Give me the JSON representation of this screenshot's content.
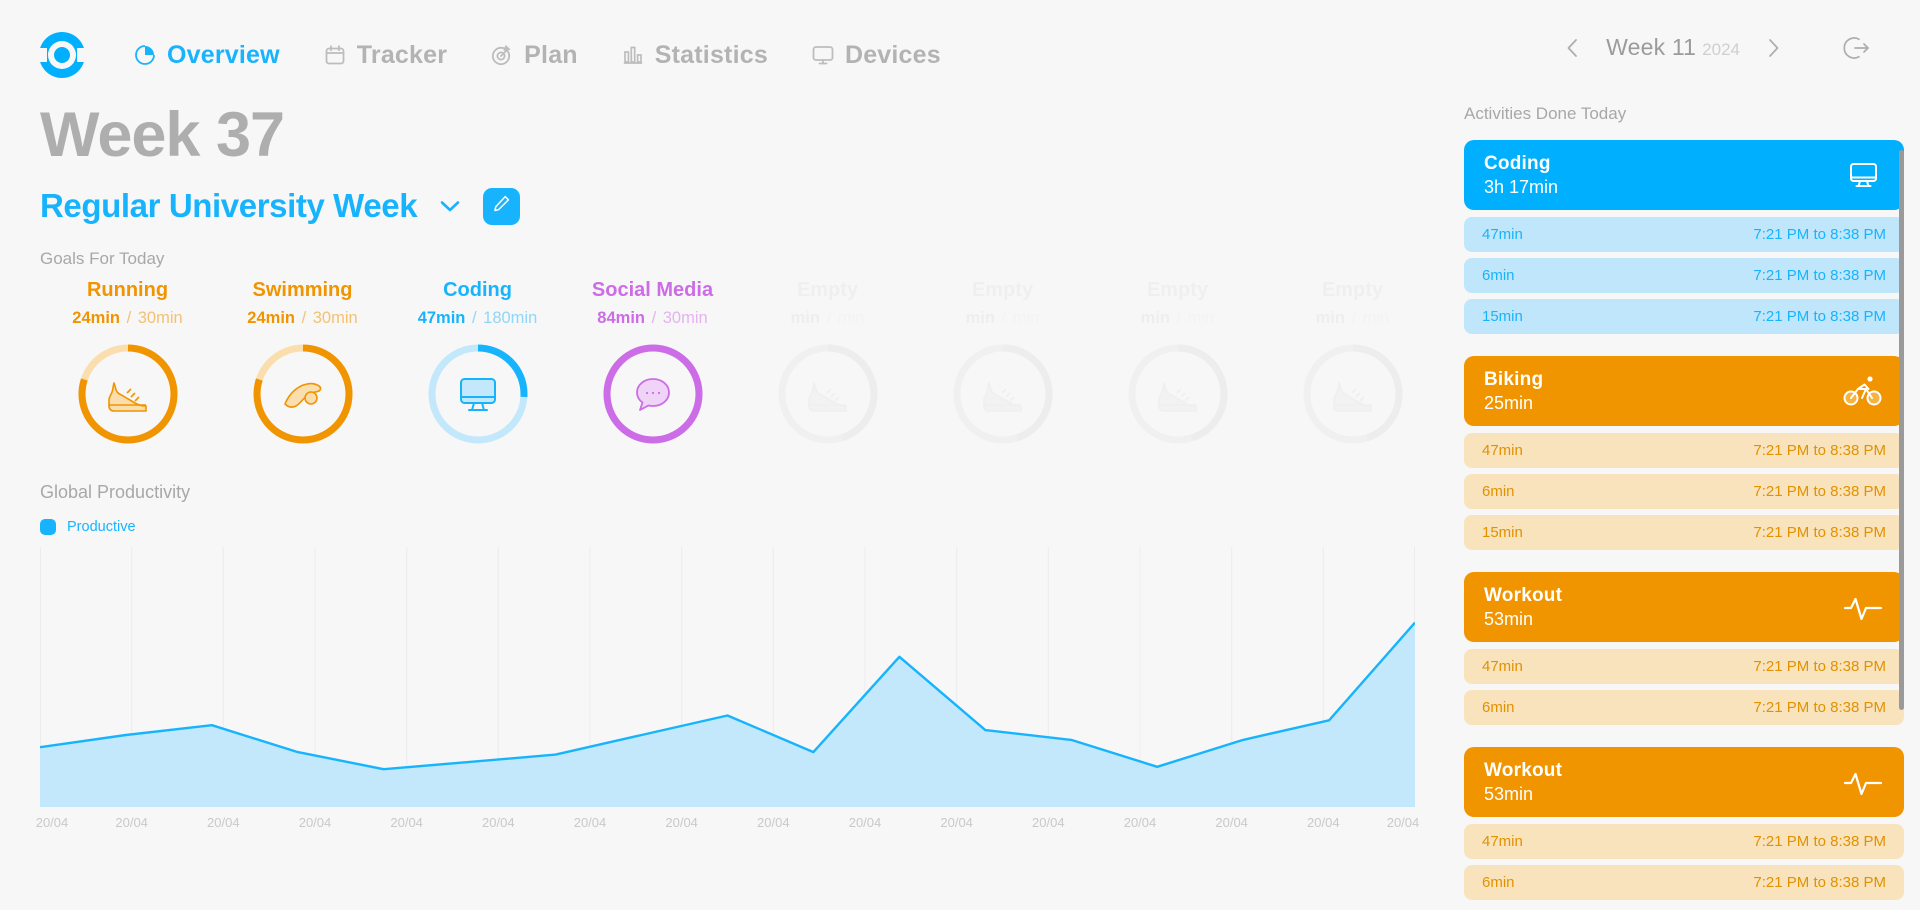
{
  "brand": {
    "logo_icon": "target-ring-logo",
    "accent_blue": "#17b4fd",
    "accent_orange": "#f09400",
    "accent_purple": "#cc6ce7",
    "empty_grey": "#ededed"
  },
  "header": {
    "nav": [
      {
        "label": "Overview",
        "icon": "pie-chart-icon",
        "active": true
      },
      {
        "label": "Tracker",
        "icon": "calendar-icon",
        "active": false
      },
      {
        "label": "Plan",
        "icon": "target-icon",
        "active": false
      },
      {
        "label": "Statistics",
        "icon": "bar-chart-icon",
        "active": false
      },
      {
        "label": "Devices",
        "icon": "monitor-icon",
        "active": false
      }
    ],
    "week_nav": {
      "prev_icon": "chevron-left-icon",
      "next_icon": "chevron-right-icon",
      "week_label": "Week 11",
      "year_label": "2024",
      "logout_icon": "logout-icon"
    }
  },
  "main": {
    "title": "Week 37",
    "subtitle": "Regular University Week",
    "dropdown_icon": "chevron-down-icon",
    "edit_icon": "pencil-icon",
    "goals_label": "Goals For Today"
  },
  "goals": [
    {
      "name": "Running",
      "current": "24min",
      "target": "30min",
      "separator": "/",
      "color": "#f09400",
      "icon": "running-shoe-icon",
      "percent": 80,
      "empty": false
    },
    {
      "name": "Swimming",
      "current": "24min",
      "target": "30min",
      "separator": "/",
      "color": "#f09400",
      "icon": "swimmer-icon",
      "percent": 80,
      "empty": false
    },
    {
      "name": "Coding",
      "current": "47min",
      "target": "180min",
      "separator": "/",
      "color": "#17b4fd",
      "icon": "monitor-icon",
      "percent": 26,
      "empty": false
    },
    {
      "name": "Social Media",
      "current": "84min",
      "target": "30min",
      "separator": "/",
      "color": "#cc6ce7",
      "icon": "chat-bubble-icon",
      "percent": 100,
      "empty": false
    },
    {
      "name": "Empty",
      "current": "min",
      "target": "min",
      "separator": "/",
      "color": "#ededed",
      "icon": "running-shoe-icon",
      "percent": 45,
      "empty": true
    },
    {
      "name": "Empty",
      "current": "min",
      "target": "min",
      "separator": "/",
      "color": "#ededed",
      "icon": "running-shoe-icon",
      "percent": 45,
      "empty": true
    },
    {
      "name": "Empty",
      "current": "min",
      "target": "min",
      "separator": "/",
      "color": "#ededed",
      "icon": "running-shoe-icon",
      "percent": 45,
      "empty": true
    },
    {
      "name": "Empty",
      "current": "min",
      "target": "min",
      "separator": "/",
      "color": "#ededed",
      "icon": "running-shoe-icon",
      "percent": 45,
      "empty": true
    }
  ],
  "chart_panel": {
    "title": "Global Productivity",
    "legend": [
      {
        "label": "Productive",
        "color": "#17b4fd"
      }
    ]
  },
  "chart_data": {
    "type": "area",
    "title": "Global Productivity",
    "xlabel": "",
    "ylabel": "",
    "grid": true,
    "legend": [
      "Productive"
    ],
    "legend_position": "top-left",
    "categories": [
      "20/04",
      "20/04",
      "20/04",
      "20/04",
      "20/04",
      "20/04",
      "20/04",
      "20/04",
      "20/04",
      "20/04",
      "20/04",
      "20/04",
      "20/04",
      "20/04",
      "20/04",
      "20/04"
    ],
    "x_tick_labels": [
      "20/04",
      "20/04",
      "20/04",
      "20/04",
      "20/04",
      "20/04",
      "20/04",
      "20/04",
      "20/04",
      "20/04",
      "20/04",
      "20/04",
      "20/04",
      "20/04",
      "20/04",
      "20/04"
    ],
    "ylim": [
      0,
      100
    ],
    "series": [
      {
        "name": "Productive",
        "color": "#17b4fd",
        "fill": "#c3e8fb",
        "values": [
          22,
          27,
          31,
          20,
          13,
          16,
          19,
          27,
          35,
          20,
          59,
          29,
          25,
          14,
          25,
          33,
          73
        ]
      }
    ]
  },
  "right_panel": {
    "title": "Activities Done Today",
    "groups": [
      {
        "name": "Coding",
        "total": "3h 17min",
        "icon": "monitor-icon",
        "theme": "blue",
        "head_bg": "#00b0ff",
        "row_bg": "#bfe6fb",
        "row_fg": "#17b4fd",
        "rows": [
          {
            "duration": "47min",
            "range": "7:21 PM to 8:38 PM"
          },
          {
            "duration": "6min",
            "range": "7:21 PM to 8:38 PM"
          },
          {
            "duration": "15min",
            "range": "7:21 PM to 8:38 PM"
          }
        ]
      },
      {
        "name": "Biking",
        "total": "25min",
        "icon": "bicycle-icon",
        "theme": "orange",
        "head_bg": "#f09400",
        "row_bg": "#f8e3bc",
        "row_fg": "#e29100",
        "rows": [
          {
            "duration": "47min",
            "range": "7:21 PM to 8:38 PM"
          },
          {
            "duration": "6min",
            "range": "7:21 PM to 8:38 PM"
          },
          {
            "duration": "15min",
            "range": "7:21 PM to 8:38 PM"
          }
        ]
      },
      {
        "name": "Workout",
        "total": "53min",
        "icon": "heartbeat-icon",
        "theme": "orange",
        "head_bg": "#f09400",
        "row_bg": "#f8e3bc",
        "row_fg": "#e29100",
        "rows": [
          {
            "duration": "47min",
            "range": "7:21 PM to 8:38 PM"
          },
          {
            "duration": "6min",
            "range": "7:21 PM to 8:38 PM"
          }
        ]
      },
      {
        "name": "Workout",
        "total": "53min",
        "icon": "heartbeat-icon",
        "theme": "orange",
        "head_bg": "#f09400",
        "row_bg": "#f8e3bc",
        "row_fg": "#e29100",
        "rows": [
          {
            "duration": "47min",
            "range": "7:21 PM to 8:38 PM"
          },
          {
            "duration": "6min",
            "range": "7:21 PM to 8:38 PM"
          }
        ]
      }
    ]
  }
}
